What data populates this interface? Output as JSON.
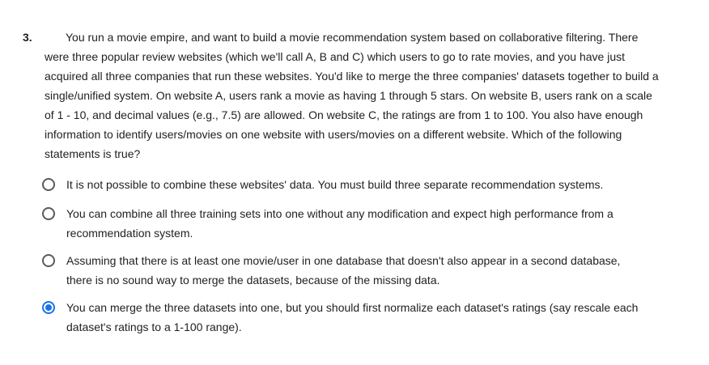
{
  "question": {
    "number": "3.",
    "text": "You run a movie empire, and want to build a movie recommendation system based on collaborative filtering. There were three popular review websites (which we'll call A, B and C) which users to go to rate movies, and you have just acquired all three companies that run these websites. You'd like to merge the three companies' datasets together to build a single/unified system.  On website A, users rank a movie as having 1 through 5 stars. On website B, users rank on a scale of 1 - 10, and decimal values (e.g., 7.5) are allowed. On website C, the ratings are from 1 to 100.  You also have enough information to identify users/movies on one website with users/movies on a different website.  Which of the following statements is true?"
  },
  "options": [
    {
      "label": "It is not possible to combine these websites' data. You must build three separate recommendation systems.",
      "selected": false
    },
    {
      "label": "You can combine all three training sets into one without any modification and expect high performance from a recommendation system.",
      "selected": false
    },
    {
      "label": "Assuming that there is at least one movie/user in one database that doesn't also appear in a second database, there is no sound way to merge the datasets, because of the missing data.",
      "selected": false
    },
    {
      "label": "You can merge the three datasets into one, but you should first normalize each dataset's ratings (say rescale each dataset's ratings to a 1-100 range).",
      "selected": true
    }
  ],
  "colors": {
    "accent": "#1a73e8",
    "text": "#1f1f1f"
  }
}
